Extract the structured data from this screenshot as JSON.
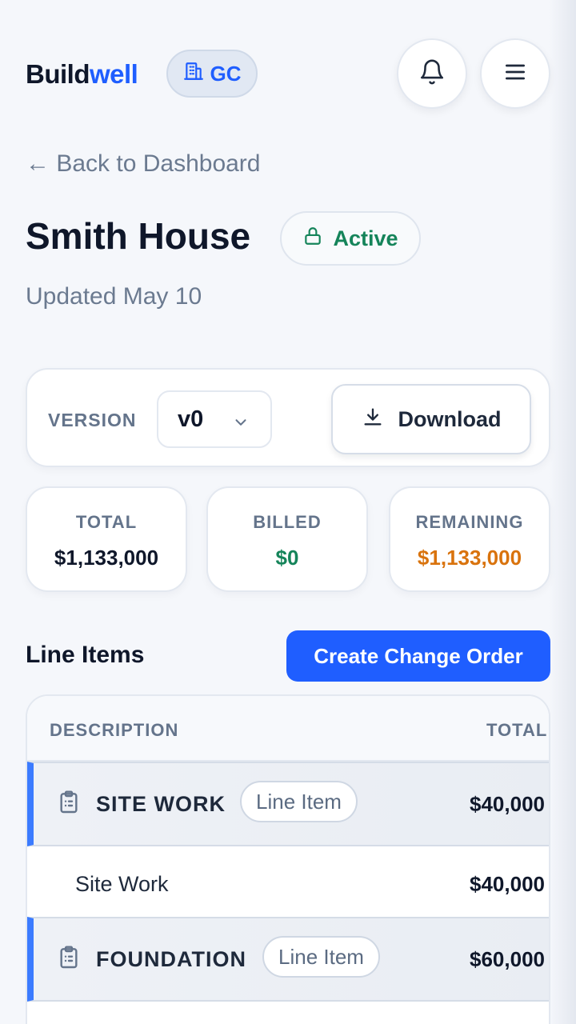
{
  "header": {
    "logo_part1": "Build",
    "logo_part2": "well",
    "role_badge": "GC",
    "icons": {
      "role": "building-icon",
      "notifications": "bell-icon",
      "menu": "hamburger-menu-icon"
    }
  },
  "back_link": "← Back to Dashboard",
  "project": {
    "name": "Smith House",
    "status": "Active",
    "updated": "Updated May 10"
  },
  "version": {
    "label": "VERSION",
    "selected": "v0",
    "download_label": "Download"
  },
  "stats": {
    "total": {
      "label": "TOTAL",
      "value": "$1,133,000",
      "color": "#0f172a"
    },
    "billed": {
      "label": "BILLED",
      "value": "$0",
      "color": "#15845a"
    },
    "remaining": {
      "label": "REMAINING",
      "value": "$1,133,000",
      "color": "#d9730d"
    }
  },
  "line_items": {
    "title": "Line Items",
    "create_button": "Create Change Order",
    "columns": {
      "description": "DESCRIPTION",
      "total": "TOTAL"
    },
    "groups": [
      {
        "name": "SITE WORK",
        "badge": "Line Item",
        "amount": "$40,000",
        "items": [
          {
            "name": "Site Work",
            "amount": "$40,000"
          }
        ]
      },
      {
        "name": "FOUNDATION",
        "badge": "Line Item",
        "amount": "$60,000",
        "items": []
      }
    ]
  },
  "colors": {
    "accent": "#1f5eff",
    "active": "#15845a",
    "remaining": "#d9730d"
  }
}
